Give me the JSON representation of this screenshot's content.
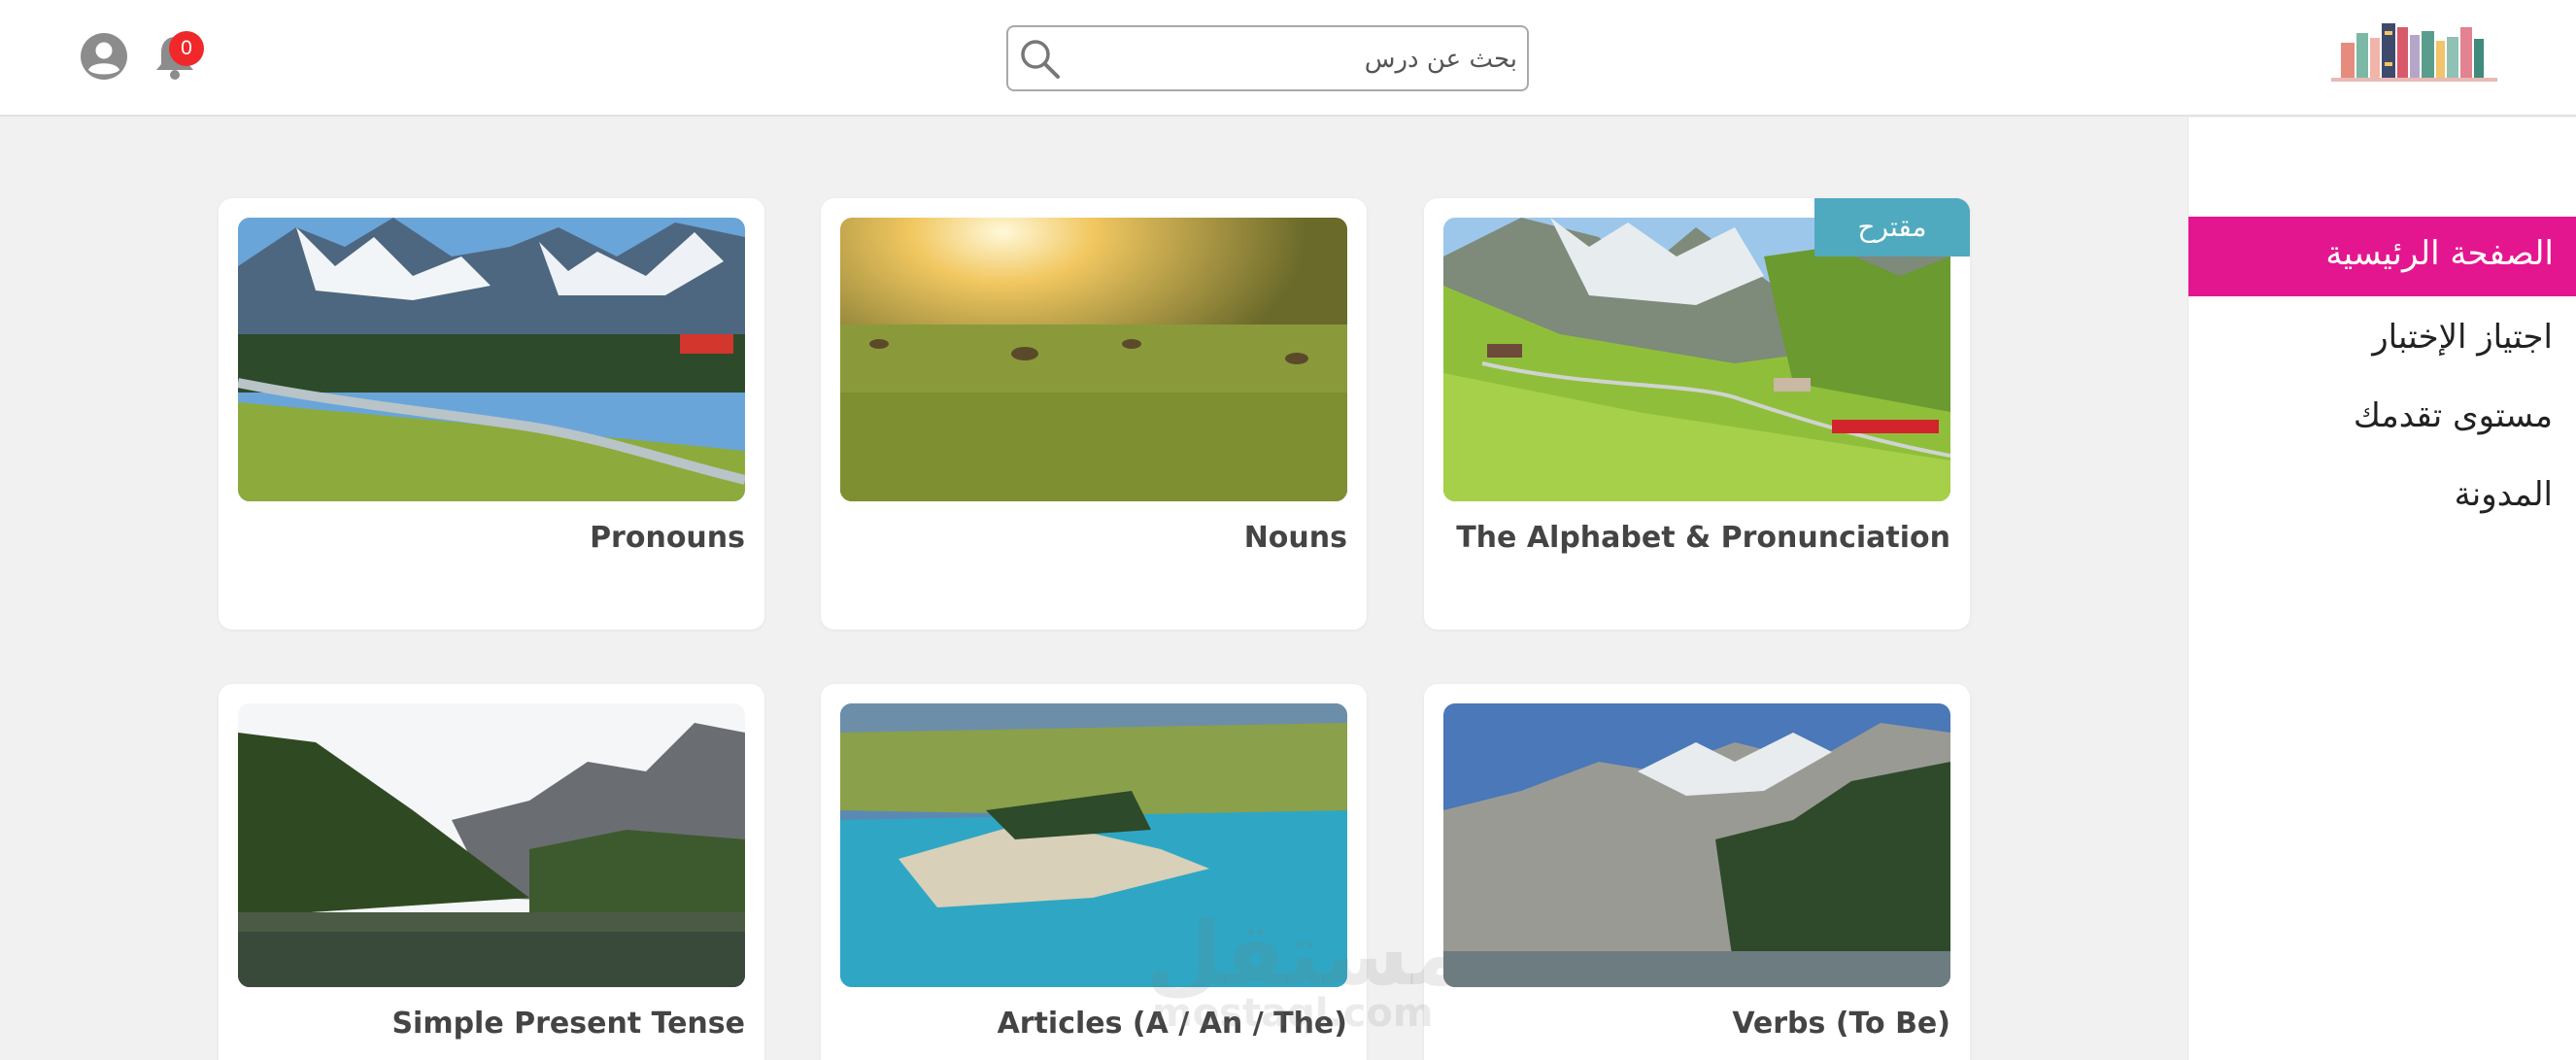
{
  "header": {
    "notification_count": "0",
    "search": {
      "placeholder": "بحث عن درس"
    }
  },
  "sidebar": {
    "items": [
      {
        "label": "الصفحة الرئيسية",
        "active": true
      },
      {
        "label": "اجتياز الإختبار",
        "active": false
      },
      {
        "label": "مستوى تقدمك",
        "active": false
      },
      {
        "label": "المدونة",
        "active": false
      }
    ]
  },
  "lessons": [
    {
      "title": "The Alphabet & Pronunciation",
      "tag": "مقترح",
      "image": "mountain-valley-train"
    },
    {
      "title": "Nouns",
      "image": "kangaroos-sunset-field"
    },
    {
      "title": "Pronouns",
      "image": "snowy-mountains-river"
    },
    {
      "title": "Verbs (To Be)",
      "image": "rocky-cliffs-lake"
    },
    {
      "title": "Articles (A / An / The)",
      "image": "turquoise-lake-aerial"
    },
    {
      "title": "Simple Present Tense",
      "image": "forested-mountain-lake"
    }
  ],
  "watermark": {
    "text": "مستقل",
    "subtext": "mostaql.com"
  },
  "colors": {
    "accent": "#e4168f",
    "tag": "#4fa9bf",
    "badge": "#f0282a"
  }
}
